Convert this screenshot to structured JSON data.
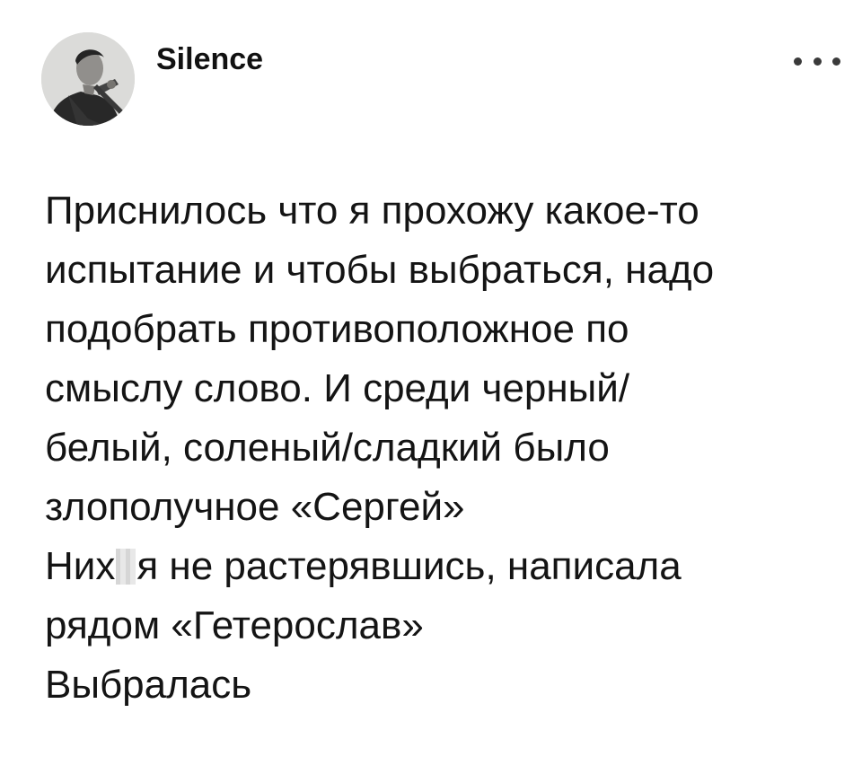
{
  "post": {
    "author": {
      "name": "Silence",
      "avatar_icon": "profile-photo"
    },
    "more_icon": "ellipsis-icon",
    "text_lines": [
      "Приснилось что я прохожу какое-то",
      "испытание и чтобы выбраться, надо",
      "подобрать противоположное по",
      "смыслу слово. И среди черный/",
      "белый, соленый/сладкий было",
      "злополучное «Сергей»"
    ],
    "censored_line": {
      "before": "Них",
      "after": "я не растерявшись, написала"
    },
    "text_lines_end": [
      "рядом «Гетерослав»",
      "Выбралась"
    ]
  }
}
